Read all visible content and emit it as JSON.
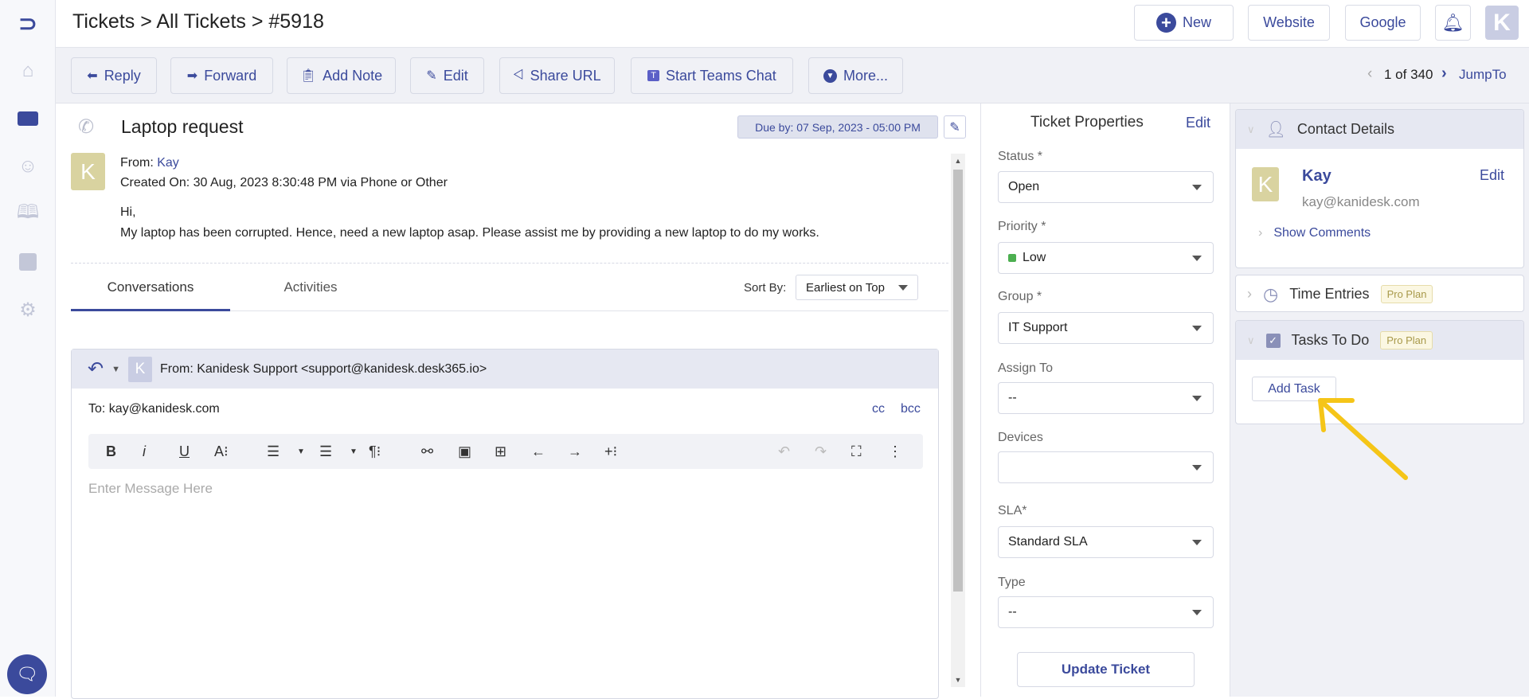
{
  "header": {
    "breadcrumb": "Tickets > All Tickets > #5918",
    "new_label": "New",
    "website_label": "Website",
    "google_label": "Google",
    "avatar_letter": "K"
  },
  "actions": {
    "reply": "Reply",
    "forward": "Forward",
    "add_note": "Add Note",
    "edit": "Edit",
    "share_url": "Share URL",
    "teams_chat": "Start Teams Chat",
    "more": "More..."
  },
  "pagination": {
    "text": "1 of 340",
    "jump": "JumpTo"
  },
  "ticket": {
    "subject": "Laptop request",
    "due": "Due by: 07 Sep, 2023 - 05:00 PM",
    "avatar_letter": "K",
    "from_label": "From:",
    "from_name": "Kay",
    "created": "Created On: 30 Aug, 2023 8:30:48 PM via Phone or Other",
    "greeting": "Hi,",
    "body": "My laptop has been corrupted. Hence, need a new laptop asap. Please assist me by providing a new laptop to do my works."
  },
  "tabs": [
    {
      "label": "Conversations",
      "active": true
    },
    {
      "label": "Activities",
      "active": false
    }
  ],
  "sort": {
    "label": "Sort By:",
    "value": "Earliest on Top"
  },
  "reply": {
    "avatar_letter": "K",
    "from": "From:  Kanidesk Support <support@kanidesk.desk365.io>",
    "to": "To: kay@kanidesk.com",
    "cc": "cc",
    "bcc": "bcc",
    "placeholder": "Enter Message Here"
  },
  "properties": {
    "title": "Ticket Properties",
    "edit": "Edit",
    "fields": [
      {
        "label": "Status *",
        "value": "Open"
      },
      {
        "label": "Priority *",
        "value": "Low",
        "color": "#4caf50"
      },
      {
        "label": "Group *",
        "value": "IT Support"
      },
      {
        "label": "Assign To",
        "value": "--"
      },
      {
        "label": "Devices",
        "value": ""
      },
      {
        "label": "SLA*",
        "value": "Standard SLA"
      },
      {
        "label": "Type",
        "value": "--"
      }
    ],
    "update": "Update Ticket"
  },
  "contact": {
    "title": "Contact Details",
    "avatar_letter": "K",
    "name": "Kay",
    "email": "kay@kanidesk.com",
    "edit": "Edit",
    "show_comments": "Show Comments"
  },
  "time_entries": {
    "title": "Time Entries",
    "badge": "Pro Plan"
  },
  "tasks": {
    "title": "Tasks To Do",
    "badge": "Pro Plan",
    "add": "Add Task"
  },
  "colors": {
    "accent": "#3b4a9c",
    "annotation_arrow": "#f5c518",
    "avatar": "#d9d3a0"
  }
}
